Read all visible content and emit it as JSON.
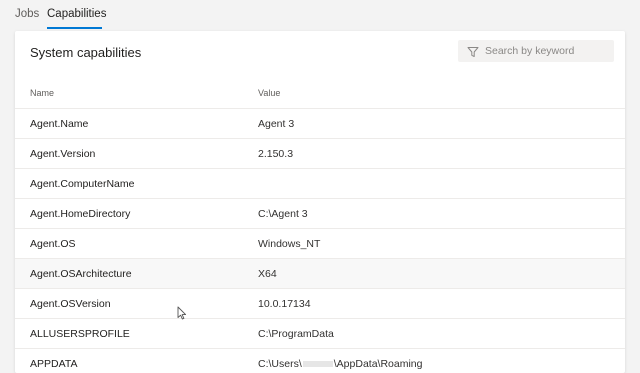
{
  "tabs": {
    "jobs": "Jobs",
    "capabilities": "Capabilities"
  },
  "card": {
    "title": "System capabilities"
  },
  "search": {
    "placeholder": "Search by keyword",
    "icon": "filter-icon"
  },
  "table": {
    "columns": {
      "name": "Name",
      "value": "Value"
    },
    "rows": [
      {
        "name": "Agent.Name",
        "value": "Agent 3"
      },
      {
        "name": "Agent.Version",
        "value": "2.150.3"
      },
      {
        "name": "Agent.ComputerName",
        "value": ""
      },
      {
        "name": "Agent.HomeDirectory",
        "value": "C:\\Agent 3"
      },
      {
        "name": "Agent.OS",
        "value": "Windows_NT"
      },
      {
        "name": "Agent.OSArchitecture",
        "value": "X64"
      },
      {
        "name": "Agent.OSVersion",
        "value": "10.0.17134"
      },
      {
        "name": "ALLUSERSPROFILE",
        "value": "C:\\ProgramData"
      },
      {
        "name": "APPDATA",
        "value_prefix": "C:\\Users\\",
        "value_suffix": "\\AppData\\Roaming"
      }
    ]
  },
  "colors": {
    "accent": "#0078d4",
    "background": "#f3f3f3",
    "card": "#ffffff",
    "row_hover": "#f8f8f8"
  }
}
